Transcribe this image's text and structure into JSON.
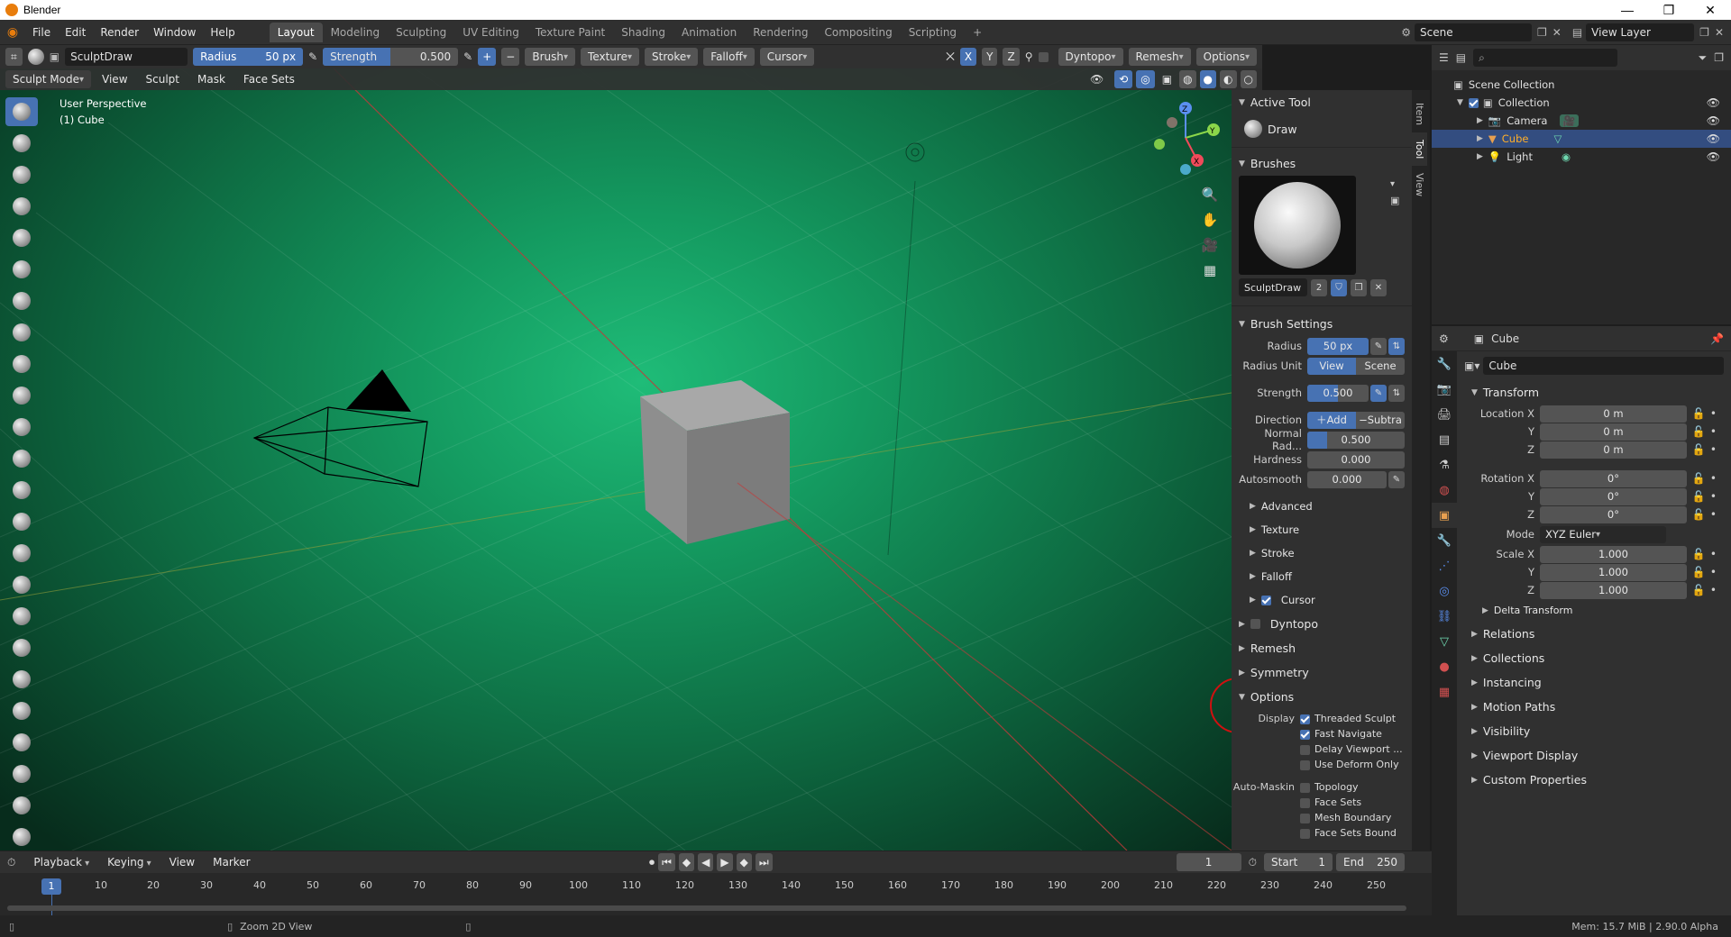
{
  "window": {
    "title": "Blender",
    "minimize": "—",
    "maximize": "❐",
    "close": "✕"
  },
  "menus": [
    "File",
    "Edit",
    "Render",
    "Window",
    "Help"
  ],
  "workspaces": [
    "Layout",
    "Modeling",
    "Sculpting",
    "UV Editing",
    "Texture Paint",
    "Shading",
    "Animation",
    "Rendering",
    "Compositing",
    "Scripting"
  ],
  "workspace_add": "+",
  "scene": {
    "name": "Scene",
    "view_layer": "View Layer"
  },
  "tool_header": {
    "brush_name": "SculptDraw",
    "radius_label": "Radius",
    "radius_value": "50 px",
    "strength_label": "Strength",
    "strength_value": "0.500",
    "plus": "+",
    "minus": "−",
    "dropdowns": [
      "Brush",
      "Texture",
      "Stroke",
      "Falloff",
      "Cursor"
    ],
    "axes": [
      "X",
      "Y",
      "Z"
    ],
    "dyntopo": "Dyntopo",
    "remesh": "Remesh",
    "options": "Options"
  },
  "viewport_header": {
    "mode": "Sculpt Mode",
    "menus": [
      "View",
      "Sculpt",
      "Mask",
      "Face Sets"
    ]
  },
  "viewport": {
    "perspective": "User Perspective",
    "object": "(1) Cube",
    "gizmo_axes": [
      "X",
      "Y",
      "Z"
    ]
  },
  "npanel": {
    "tabs": [
      "Item",
      "Tool",
      "View"
    ],
    "active_tool_title": "Active Tool",
    "active_tool": "Draw",
    "brushes_title": "Brushes",
    "brush_name": "SculptDraw",
    "brush_users": "2",
    "brush_settings_title": "Brush Settings",
    "radius_label": "Radius",
    "radius_value": "50 px",
    "radius_unit_label": "Radius Unit",
    "radius_unit_view": "View",
    "radius_unit_scene": "Scene",
    "strength_label": "Strength",
    "strength_value": "0.500",
    "strength_fill": 0.5,
    "direction_label": "Direction",
    "direction_add": "Add",
    "direction_sub": "Subtra",
    "normal_radius_label": "Normal Rad...",
    "normal_radius_value": "0.500",
    "normal_radius_fill": 0.5,
    "hardness_label": "Hardness",
    "hardness_value": "0.000",
    "autosmooth_label": "Autosmooth",
    "autosmooth_value": "0.000",
    "subpanels": [
      "Advanced",
      "Texture",
      "Stroke",
      "Falloff",
      "Cursor"
    ],
    "sections": [
      "Dyntopo",
      "Remesh",
      "Symmetry",
      "Options"
    ],
    "display_label": "Display",
    "display_opts": [
      {
        "label": "Threaded Sculpt",
        "on": true
      },
      {
        "label": "Fast Navigate",
        "on": true
      },
      {
        "label": "Delay Viewport ...",
        "on": false
      },
      {
        "label": "Use Deform Only",
        "on": false
      }
    ],
    "automask_label": "Auto-Maskin",
    "automask_opts": [
      "Topology",
      "Face Sets",
      "Mesh Boundary",
      "Face Sets Bound"
    ]
  },
  "outliner": {
    "root": "Scene Collection",
    "collection": "Collection",
    "items": [
      "Camera",
      "Cube",
      "Light"
    ]
  },
  "properties": {
    "object_name": "Cube",
    "data_name": "Cube",
    "transform_title": "Transform",
    "location": {
      "label": "Location X",
      "x": "0 m",
      "y": "0 m",
      "z": "0 m"
    },
    "rotation": {
      "label": "Rotation X",
      "x": "0°",
      "y": "0°",
      "z": "0°"
    },
    "mode_label": "Mode",
    "mode_value": "XYZ Euler",
    "scale": {
      "label": "Scale X",
      "x": "1.000",
      "y": "1.000",
      "z": "1.000"
    },
    "axis_y": "Y",
    "axis_z": "Z",
    "delta": "Delta Transform",
    "sections": [
      "Relations",
      "Collections",
      "Instancing",
      "Motion Paths",
      "Visibility",
      "Viewport Display",
      "Custom Properties"
    ]
  },
  "timeline": {
    "menus": [
      "Playback",
      "Keying",
      "View",
      "Marker"
    ],
    "current_frame": "1",
    "start_label": "Start",
    "start_value": "1",
    "end_label": "End",
    "end_value": "250",
    "ticks": [
      "1",
      "10",
      "20",
      "30",
      "40",
      "50",
      "60",
      "70",
      "80",
      "90",
      "100",
      "110",
      "120",
      "130",
      "140",
      "150",
      "160",
      "170",
      "180",
      "190",
      "200",
      "210",
      "220",
      "230",
      "240",
      "250"
    ]
  },
  "status": {
    "hint": "Zoom 2D View",
    "mem": "Mem: 15.7 MiB | 2.90.0 Alpha"
  },
  "colors": {
    "accent": "#4772b3",
    "viewport_center": "#1fbc78",
    "selected_row": "#334d80"
  }
}
